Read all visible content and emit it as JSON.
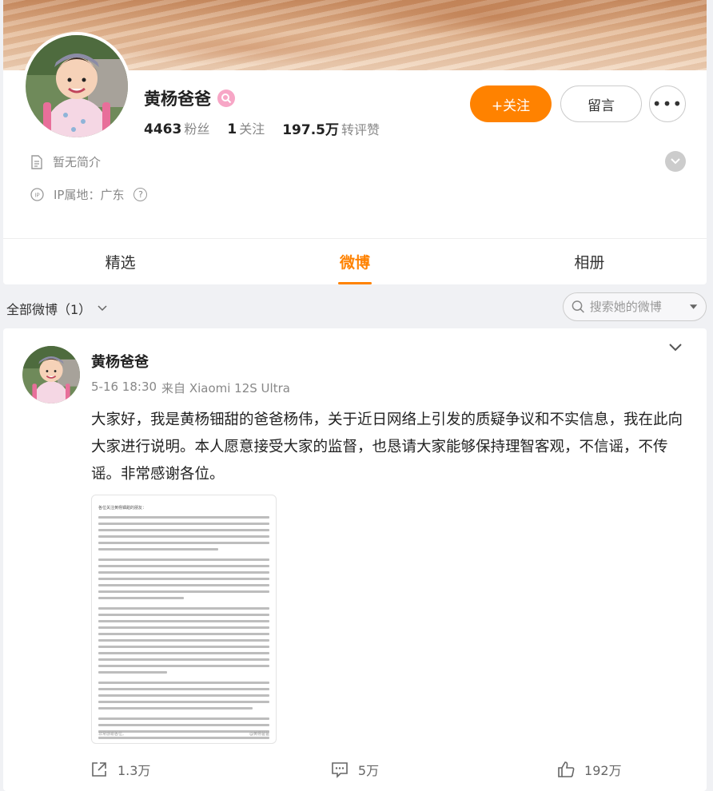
{
  "profile": {
    "name": "黄杨爸爸",
    "stats": [
      {
        "value": "4463",
        "label": "粉丝"
      },
      {
        "value": "1",
        "label": "关注"
      },
      {
        "value": "197.5万",
        "label": "转评赞"
      }
    ],
    "follow_label": "+关注",
    "message_label": "留言",
    "more_label": "•••",
    "bio": "暂无简介",
    "ip_location": "IP属地：广东"
  },
  "tabs": [
    {
      "label": "精选",
      "active": false
    },
    {
      "label": "微博",
      "active": true
    },
    {
      "label": "相册",
      "active": false
    }
  ],
  "filter": {
    "label": "全部微博（1）",
    "search_placeholder": "搜索她的微博"
  },
  "post": {
    "author": "黄杨爸爸",
    "time": "5-16 18:30",
    "source": "来自 Xiaomi 12S Ultra",
    "text": "大家好，我是黄杨钿甜的爸爸杨伟，关于近日网络上引发的质疑争议和不实信息，我在此向大家进行说明。本人愿意接受大家的监督，也恳请大家能够保持理智客观，不信谣，不传谣。非常感谢各位。",
    "image_title": "各位关注黄杨钿甜的朋友：",
    "image_sign_off": "非常感谢各位。",
    "image_watermark": "@黄杨爸爸",
    "repost_count": "1.3万",
    "comment_count": "5万",
    "like_count": "192万"
  },
  "colors": {
    "accent": "#ff8200",
    "muted": "#888888"
  }
}
